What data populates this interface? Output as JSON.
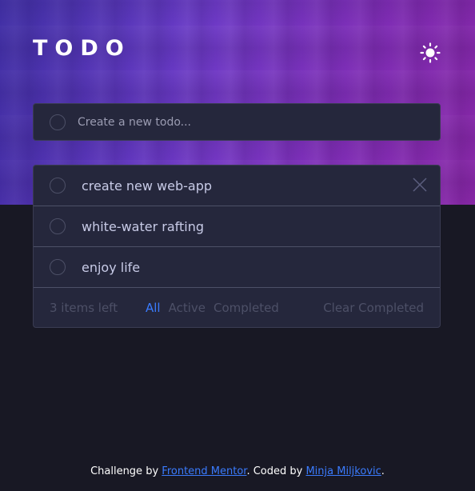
{
  "header": {
    "title": "TODO",
    "theme_icon": "sun-icon"
  },
  "new_todo": {
    "placeholder": "Create a new todo..."
  },
  "todos": [
    {
      "text": "create new web-app",
      "completed": false
    },
    {
      "text": "white-water rafting",
      "completed": false
    },
    {
      "text": "enjoy life",
      "completed": false
    }
  ],
  "footer": {
    "items_left": "3 items left",
    "filters": [
      "All",
      "Active",
      "Completed"
    ],
    "active_filter": "All",
    "clear_label": "Clear Completed"
  },
  "credit": {
    "prefix": "Challenge by ",
    "link1": "Frontend Mentor",
    "middle": ". Coded by ",
    "link2": "Minja Miljkovic",
    "suffix": "."
  },
  "colors": {
    "accent": "#3a7bfd",
    "background": "#181824",
    "card": "#25273c"
  }
}
